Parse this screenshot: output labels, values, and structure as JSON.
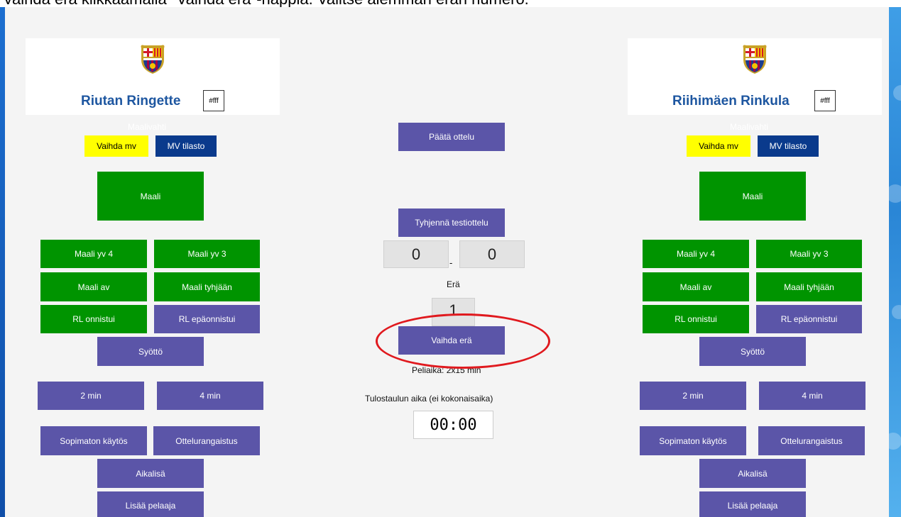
{
  "instruction": "Vaihda erä klikkaamalla \"Vaihda erä\"-nappia. Valitse aiemman erän numero.",
  "colors": {
    "green": "#009400",
    "purple": "#5b55a8",
    "navy": "#0a3a8c",
    "yellow": "#ffff00",
    "team_name": "#1d56a0",
    "highlight": "#e0191e"
  },
  "left_team": {
    "name": "Riutan Ringette",
    "color_value": "#fff",
    "ghost": "Maalivahti",
    "change_goalie": "Vaihda mv",
    "goalie_stats": "MV tilasto",
    "goal": "Maali",
    "goal_pp4": "Maali yv 4",
    "goal_pp3": "Maali yv 3",
    "goal_sh": "Maali av",
    "goal_empty": "Maali tyhjään",
    "penalty_ok": "RL onnistui",
    "penalty_fail": "RL epäonnistui",
    "assist": "Syöttö",
    "pen_2min": "2 min",
    "pen_4min": "4 min",
    "misconduct": "Sopimaton käytös",
    "match_penalty": "Ottelurangaistus",
    "timeout": "Aikalisä",
    "add_player": "Lisää pelaaja"
  },
  "right_team": {
    "name": "Riihimäen Rinkula",
    "color_value": "#fff",
    "ghost": "Maalivahti",
    "change_goalie": "Vaihda mv",
    "goalie_stats": "MV tilasto",
    "goal": "Maali",
    "goal_pp4": "Maali yv 4",
    "goal_pp3": "Maali yv 3",
    "goal_sh": "Maali av",
    "goal_empty": "Maali tyhjään",
    "penalty_ok": "RL onnistui",
    "penalty_fail": "RL epäonnistui",
    "assist": "Syöttö",
    "pen_2min": "2 min",
    "pen_4min": "4 min",
    "misconduct": "Sopimaton käytös",
    "match_penalty": "Ottelurangaistus",
    "timeout": "Aikalisä",
    "add_player": "Lisää pelaaja"
  },
  "center": {
    "end_match": "Päätä ottelu",
    "clear_test": "Tyhjennä testiottelu",
    "score_left": "0",
    "score_sep": "-",
    "score_right": "0",
    "period_label": "Erä",
    "period_value": "1",
    "change_period": "Vaihda erä",
    "game_time": "Peliaika: 2x15 min",
    "clock_label": "Tulostaulun aika (ei kokonaisaika)",
    "clock_value": "00:00"
  }
}
